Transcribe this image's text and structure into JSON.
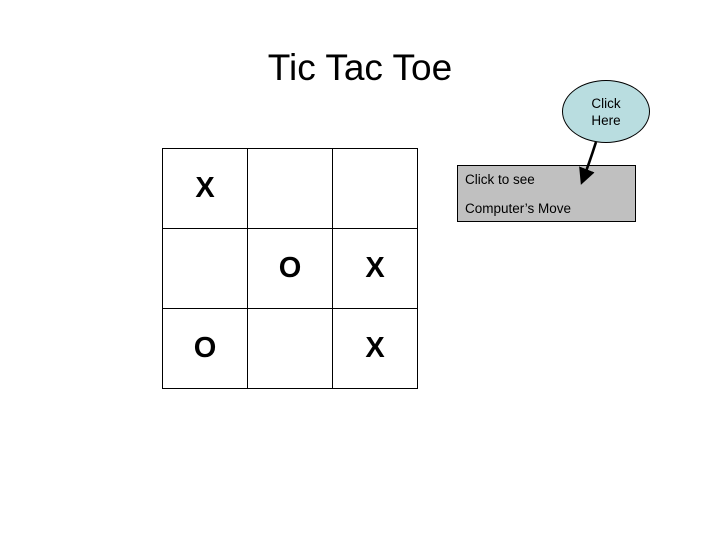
{
  "slide": {
    "background_color": "#ffffff",
    "title": "Tic Tac Toe"
  },
  "board": {
    "name": "tic-tac-toe-grid",
    "rows": 3,
    "columns": 3,
    "border_color": "#000000",
    "cell_background": "#ffffff",
    "cells": [
      [
        "X",
        "",
        ""
      ],
      [
        "",
        "O",
        "X"
      ],
      [
        "O",
        "",
        "X"
      ]
    ]
  },
  "callout": {
    "background_color": "#c0c0c0",
    "border_color": "#000000",
    "line1": "Click to see",
    "line2": "Computer’s Move"
  },
  "oval": {
    "fill_color": "#b9dde0",
    "border_color": "#000000",
    "line1": "Click",
    "line2": "Here"
  },
  "arrow": {
    "name": "pointer-arrow",
    "color": "#000000",
    "points_from": "click-here-oval",
    "points_to": "computer-move-callout"
  }
}
